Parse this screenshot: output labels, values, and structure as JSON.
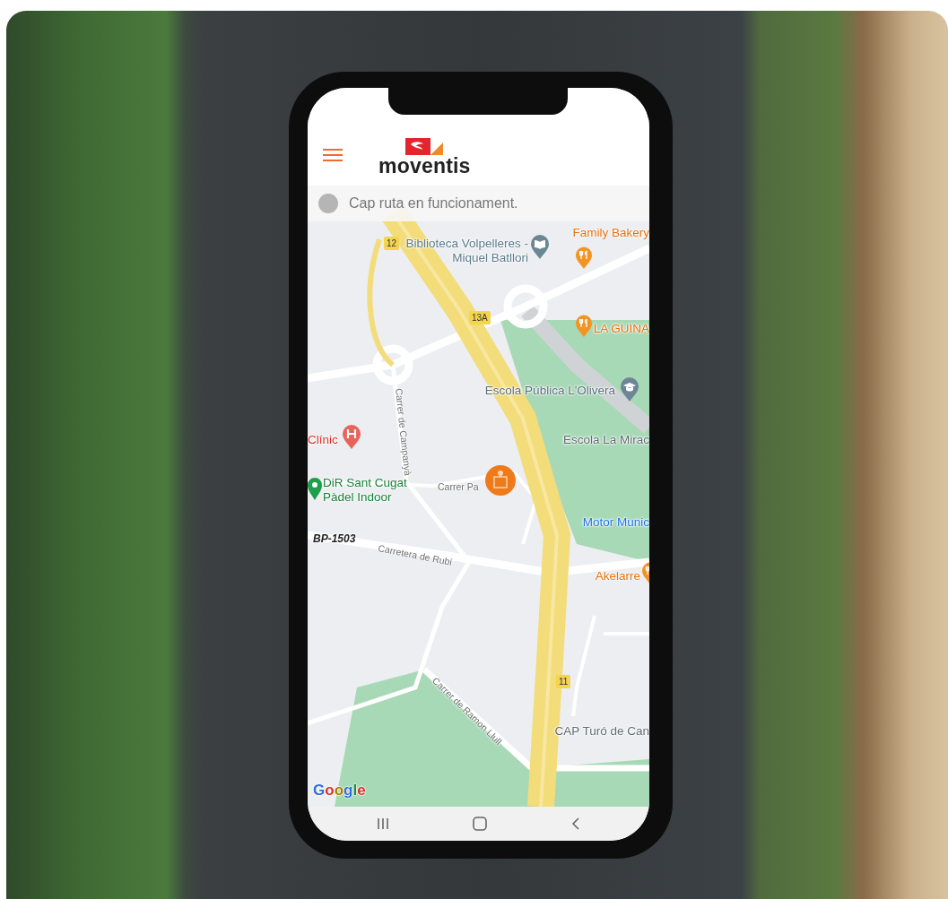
{
  "header": {
    "logo_text": "moventis"
  },
  "route_status": {
    "text": "Cap ruta en funcionament.",
    "active": false
  },
  "map": {
    "labels": [
      {
        "kind": "shield",
        "text": "12"
      },
      {
        "kind": "library",
        "text": "Biblioteca Volpelleres - Miquel Batllori"
      },
      {
        "kind": "food",
        "text": "Family Bakery"
      },
      {
        "kind": "shield",
        "text": "13A"
      },
      {
        "kind": "food",
        "text": "LA GUINA"
      },
      {
        "kind": "school",
        "text": "Escola Pública L'Olivera"
      },
      {
        "kind": "street",
        "text": "Carrer de Campanyà"
      },
      {
        "kind": "health",
        "text": "Clínic"
      },
      {
        "kind": "place",
        "text": "Escola La Mirac"
      },
      {
        "kind": "sport",
        "text": "DiR Sant Cugat Pàdel Indoor"
      },
      {
        "kind": "street",
        "text": "Carrer Pa"
      },
      {
        "kind": "transport",
        "text": "Motor Munic"
      },
      {
        "kind": "road",
        "text": "BP-1503"
      },
      {
        "kind": "street",
        "text": "Carretera de Rubí"
      },
      {
        "kind": "food",
        "text": "Akelarre"
      },
      {
        "kind": "shield",
        "text": "11"
      },
      {
        "kind": "street",
        "text": "Carrer de Ramon Llull"
      },
      {
        "kind": "place",
        "text": "CAP Turó de Can"
      }
    ],
    "attribution": "Google"
  }
}
